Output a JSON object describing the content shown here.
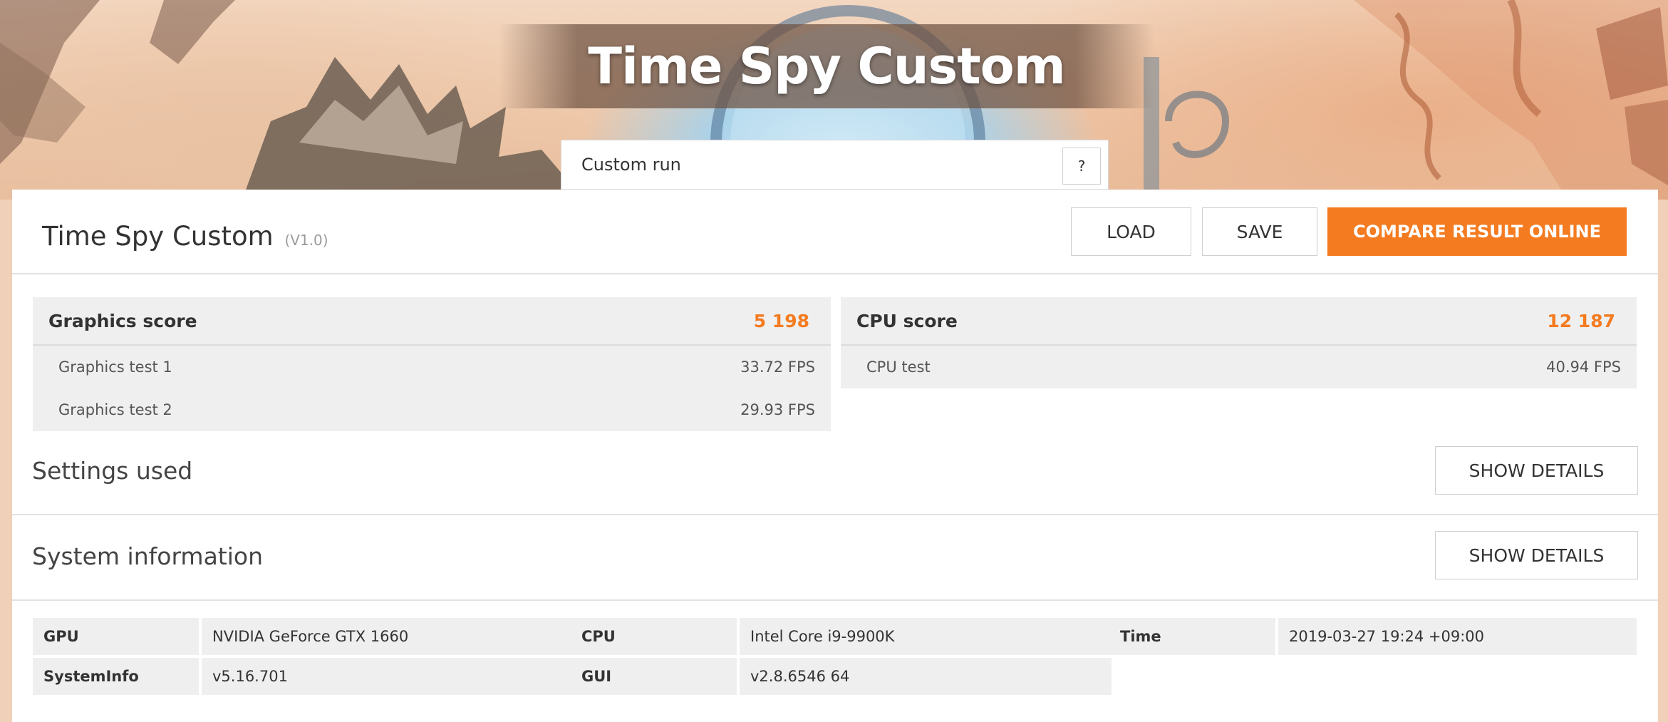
{
  "banner": {
    "title": "Time Spy Custom",
    "preset_value": "Custom run",
    "help_label": "?"
  },
  "header": {
    "name": "Time Spy Custom",
    "version": "(V1.0)",
    "load_label": "LOAD",
    "save_label": "SAVE",
    "compare_label": "COMPARE RESULT ONLINE"
  },
  "graphics": {
    "label": "Graphics score",
    "score": "5 198",
    "tests": [
      {
        "name": "Graphics test 1",
        "value": "33.72 FPS"
      },
      {
        "name": "Graphics test 2",
        "value": "29.93 FPS"
      }
    ]
  },
  "cpu": {
    "label": "CPU score",
    "score": "12 187",
    "tests": [
      {
        "name": "CPU test",
        "value": "40.94 FPS"
      }
    ]
  },
  "settings": {
    "title": "Settings used",
    "button": "SHOW DETAILS"
  },
  "sysinfo": {
    "title": "System information",
    "button": "SHOW DETAILS",
    "rows": [
      {
        "key": "GPU",
        "value": "NVIDIA GeForce GTX 1660"
      },
      {
        "key": "CPU",
        "value": "Intel Core i9-9900K"
      },
      {
        "key": "Time",
        "value": "2019-03-27 19:24 +09:00"
      },
      {
        "key": "SystemInfo",
        "value": "v5.16.701"
      },
      {
        "key": "GUI",
        "value": "v2.8.6546 64"
      }
    ]
  },
  "colors": {
    "accent": "#f47b20",
    "panel_bg": "#ffffff",
    "cell_bg": "#efefef"
  }
}
